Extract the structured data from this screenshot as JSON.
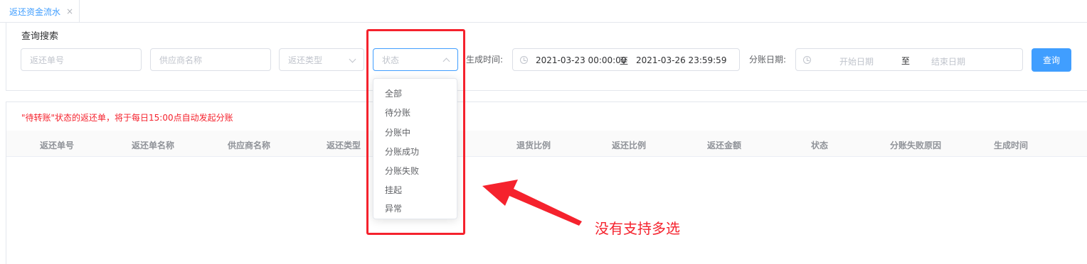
{
  "tab": {
    "label": "返还资金流水",
    "close": "×"
  },
  "query": {
    "title": "查询搜索",
    "refund_no_placeholder": "返还单号",
    "supplier_placeholder": "供应商名称",
    "type_placeholder": "返还类型",
    "status_placeholder": "状态",
    "created_label": "生成时间:",
    "created_start": "2021-03-23 00:00:00",
    "created_sep": "至",
    "created_end": "2021-03-26 23:59:59",
    "split_label": "分账日期:",
    "split_start_placeholder": "开始日期",
    "split_sep": "至",
    "split_end_placeholder": "结束日期",
    "search_button": "查询"
  },
  "notice": "\"待转账\"状态的返还单，将于每日15:00点自动发起分账",
  "table": {
    "headers": [
      "返还单号",
      "返还单名称",
      "供应商名称",
      "返还类型",
      "退货比例",
      "返还比例",
      "返还金额",
      "状态",
      "分账失败原因",
      "生成时间"
    ]
  },
  "status_options": [
    "全部",
    "待分账",
    "分账中",
    "分账成功",
    "分账失败",
    "挂起",
    "异常"
  ],
  "annotation": {
    "text": "没有支持多选",
    "color": "#f5222d"
  },
  "colors": {
    "primary": "#409eff",
    "annotation_red": "#f5222d"
  }
}
